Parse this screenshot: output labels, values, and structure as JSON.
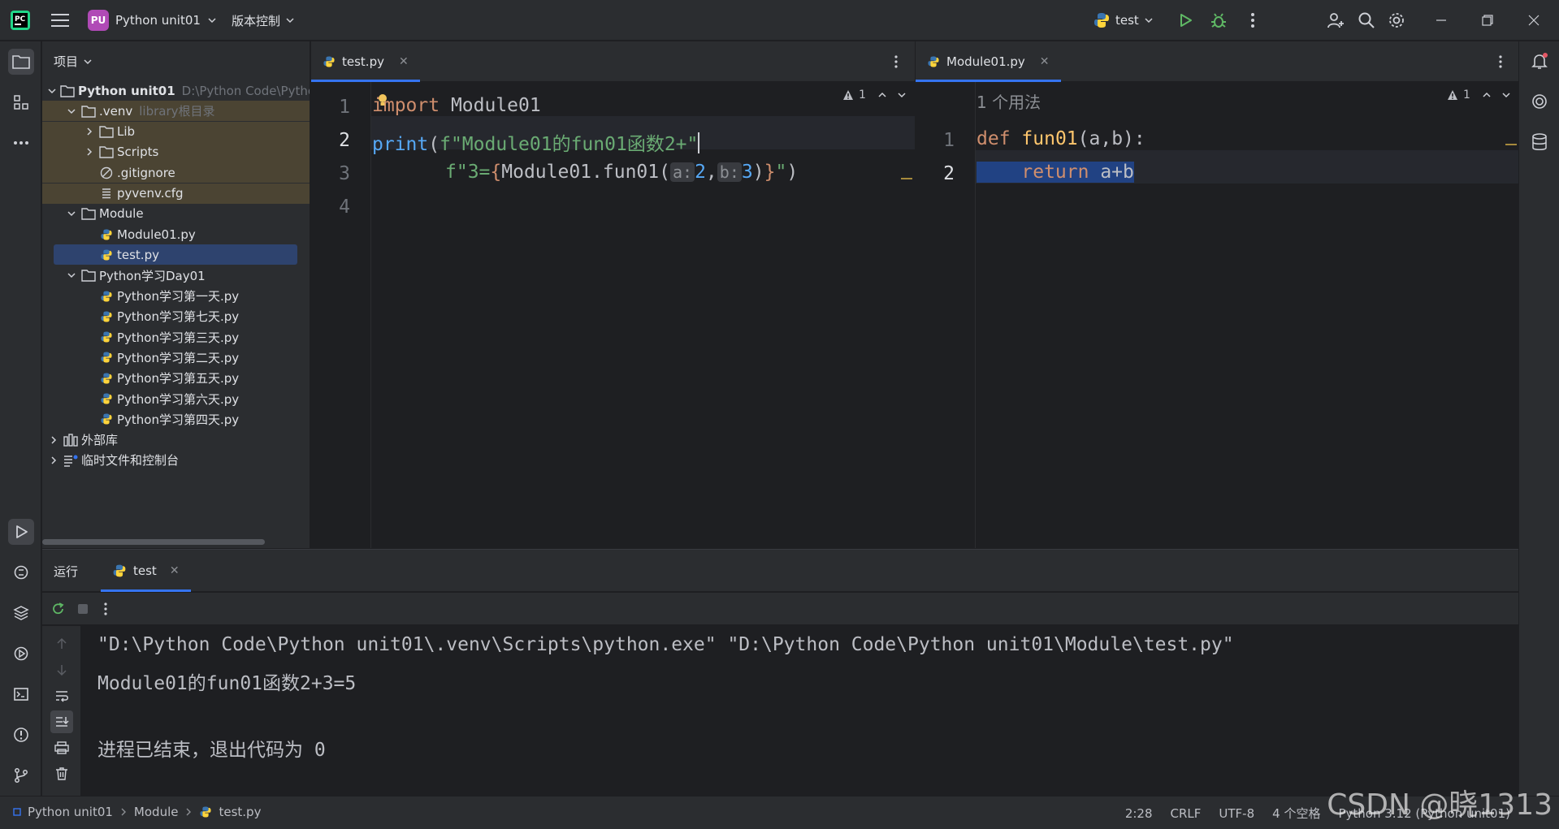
{
  "titlebar": {
    "project_badge": "PU",
    "project_name": "Python unit01",
    "vcs_label": "版本控制",
    "run_config": "test",
    "colors": {
      "badge": "#b04ab6",
      "run": "#5fb865",
      "debug": "#5fb865"
    }
  },
  "project": {
    "header": "项目",
    "tree": [
      {
        "label": "Python unit01",
        "hint": "D:\\Python Code\\Python unit01",
        "icon": "folder-icon",
        "chev": "down",
        "depth": 0,
        "bold": true
      },
      {
        "label": ".venv",
        "hint": "library根目录",
        "icon": "folder-icon",
        "chev": "down",
        "depth": 1,
        "excluded": true
      },
      {
        "label": "Lib",
        "icon": "folder-icon",
        "chev": "right",
        "depth": 2,
        "excluded": true
      },
      {
        "label": "Scripts",
        "icon": "folder-icon",
        "chev": "right",
        "depth": 2,
        "excluded": true
      },
      {
        "label": ".gitignore",
        "icon": "ignore-file-icon",
        "depth": 2,
        "excluded": true
      },
      {
        "label": "pyvenv.cfg",
        "icon": "config-file-icon",
        "depth": 2,
        "excluded": true
      },
      {
        "label": "Module",
        "icon": "folder-icon",
        "chev": "down",
        "depth": 1
      },
      {
        "label": "Module01.py",
        "icon": "python-file-icon",
        "depth": 2
      },
      {
        "label": "test.py",
        "icon": "python-file-icon",
        "depth": 2,
        "selected": true
      },
      {
        "label": "Python学习Day01",
        "icon": "folder-icon",
        "chev": "down",
        "depth": 1
      },
      {
        "label": "Python学习第一天.py",
        "icon": "python-file-icon",
        "depth": 2
      },
      {
        "label": "Python学习第七天.py",
        "icon": "python-file-icon",
        "depth": 2
      },
      {
        "label": "Python学习第三天.py",
        "icon": "python-file-icon",
        "depth": 2
      },
      {
        "label": "Python学习第二天.py",
        "icon": "python-file-icon",
        "depth": 2
      },
      {
        "label": "Python学习第五天.py",
        "icon": "python-file-icon",
        "depth": 2
      },
      {
        "label": "Python学习第六天.py",
        "icon": "python-file-icon",
        "depth": 2
      },
      {
        "label": "Python学习第四天.py",
        "icon": "python-file-icon",
        "depth": 2
      },
      {
        "label": "外部库",
        "icon": "library-icon",
        "chev": "right",
        "depth": 0
      },
      {
        "label": "临时文件和控制台",
        "icon": "scratches-icon",
        "chev": "right",
        "depth": 0
      }
    ]
  },
  "editor_left": {
    "tab": "test.py",
    "warnings": "1",
    "line_numbers": [
      "1",
      "2",
      "3",
      "4"
    ],
    "code": {
      "l1_kw": "import",
      "l1_rest": " Module01",
      "l2_fn": "print",
      "l2_p": "(",
      "l2_str": "f\"Module01的fun01函数2+\"",
      "l3_str1": "f\"3=",
      "l3_brace1": "{",
      "l3_call": "Module01.fun01(",
      "l3_hint_a": "a:",
      "l3_arg1": "2",
      "l3_comma": ",",
      "l3_hint_b": "b:",
      "l3_arg2": "3",
      "l3_close": ")",
      "l3_brace2": "}",
      "l3_str2": "\"",
      "l3_end": ")"
    }
  },
  "editor_right": {
    "tab": "Module01.py",
    "warnings": "1",
    "usage_hint": "1 个用法",
    "line_numbers": [
      "1",
      "2"
    ],
    "code": {
      "l1_kw": "def",
      "l1_fn": "fun01",
      "l1_params": "(a,b):",
      "l2_indent": "    ",
      "l2_kw": "return",
      "l2_rest": " a+b"
    }
  },
  "run": {
    "title": "运行",
    "tab": "test",
    "output": [
      "\"D:\\Python Code\\Python unit01\\.venv\\Scripts\\python.exe\" \"D:\\Python Code\\Python unit01\\Module\\test.py\"",
      "Module01的fun01函数2+3=5",
      "",
      "进程已结束，退出代码为 0"
    ]
  },
  "statusbar": {
    "crumbs": [
      "Python unit01",
      "Module",
      "test.py"
    ],
    "position": "2:28",
    "line_sep": "CRLF",
    "encoding": "UTF-8",
    "indent": "4 个空格",
    "interpreter": "Python 3.12 (Python unit01)"
  },
  "watermark": "CSDN @晓1313"
}
